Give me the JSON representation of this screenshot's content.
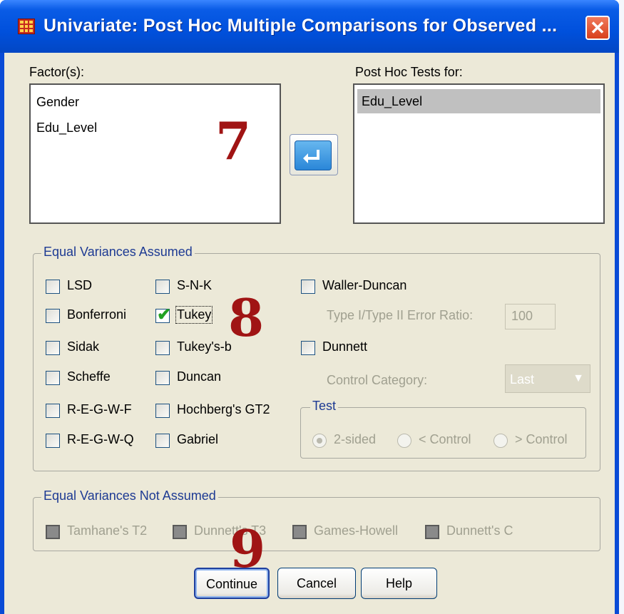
{
  "window": {
    "title": "Univariate: Post Hoc Multiple Comparisons for Observed ...",
    "close_glyph": "✕"
  },
  "factors": {
    "label": "Factor(s):",
    "items": [
      "Gender",
      "Edu_Level"
    ]
  },
  "post_hoc": {
    "label": "Post Hoc Tests for:",
    "items": [
      "Edu_Level"
    ]
  },
  "move_button": {
    "icon": "arrow-left-icon"
  },
  "equal_assumed": {
    "title": "Equal Variances Assumed",
    "options": {
      "lsd": {
        "label": "LSD",
        "checked": false
      },
      "bonferroni": {
        "label": "Bonferroni",
        "checked": false
      },
      "sidak": {
        "label": "Sidak",
        "checked": false
      },
      "scheffe": {
        "label": "Scheffe",
        "checked": false
      },
      "regwf": {
        "label": "R-E-G-W-F",
        "checked": false
      },
      "regwq": {
        "label": "R-E-G-W-Q",
        "checked": false
      },
      "snk": {
        "label": "S-N-K",
        "checked": false
      },
      "tukey": {
        "label": "Tukey",
        "checked": true
      },
      "tukeyb": {
        "label": "Tukey's-b",
        "checked": false
      },
      "duncan": {
        "label": "Duncan",
        "checked": false
      },
      "hochberg": {
        "label": "Hochberg's GT2",
        "checked": false
      },
      "gabriel": {
        "label": "Gabriel",
        "checked": false
      },
      "waller": {
        "label": "Waller-Duncan",
        "checked": false
      },
      "dunnett": {
        "label": "Dunnett",
        "checked": false
      }
    },
    "ratio_label": "Type I/Type II Error Ratio:",
    "ratio_value": "100",
    "control_label": "Control Category:",
    "control_value": "Last",
    "test": {
      "title": "Test",
      "options": [
        "2-sided",
        "< Control",
        "> Control"
      ],
      "selected": "2-sided"
    }
  },
  "equal_not_assumed": {
    "title": "Equal Variances Not Assumed",
    "options": [
      "Tamhane's T2",
      "Dunnett's T3",
      "Games-Howell",
      "Dunnett's C"
    ]
  },
  "buttons": {
    "continue": "Continue",
    "cancel": "Cancel",
    "help": "Help"
  },
  "annotations": {
    "a7": "7",
    "a8": "8",
    "a9": "9"
  },
  "colors": {
    "titlebar": "#0050dc",
    "client": "#ece9d8",
    "annotation": "#a01414",
    "group_title": "#1d3a93"
  }
}
